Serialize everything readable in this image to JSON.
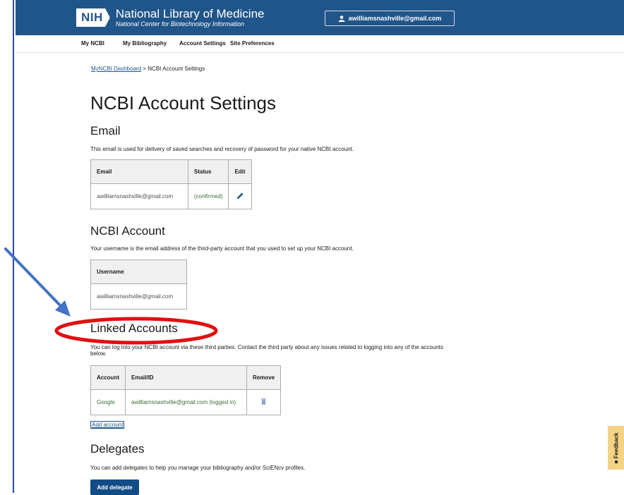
{
  "header": {
    "logo_badge": "NIH",
    "title": "National Library of Medicine",
    "subtitle": "National Center for Biotechnology Information",
    "account_email": "awilliamsnashville@gmail.com"
  },
  "nav": {
    "items": [
      "My NCBI",
      "My Bibliography",
      "Account Settings",
      "Site Preferences"
    ]
  },
  "breadcrumb": {
    "link": "MyNCBI Dashboard",
    "separator": " > ",
    "current": "NCBI Account Settings"
  },
  "page_title": "NCBI Account Settings",
  "email_section": {
    "heading": "Email",
    "description": "This email is used for delivery of saved searches and recovery of password for your native NCBI account.",
    "headers": [
      "Email",
      "Status",
      "Edit"
    ],
    "row": {
      "email": "awilliamsnashville@gmail.com",
      "status": "(confirmed)"
    }
  },
  "account_section": {
    "heading": "NCBI Account",
    "description": "Your username is the email address of the third-party account that you used to set up your NCBI account.",
    "header": "Username",
    "value": "awilliamsnashville@gmail.com"
  },
  "linked_section": {
    "heading": "Linked Accounts",
    "description": "You can log into your NCBI account via these third parties. Contact the third party about any issues related to logging into any of the accounts below.",
    "headers": [
      "Account",
      "Email/ID",
      "Remove"
    ],
    "row": {
      "account": "Google",
      "email": "awilliamsnashville@gmail.com (logged in)"
    },
    "add_link": "Add account"
  },
  "delegates_section": {
    "heading": "Delegates",
    "description": "You can add delegates to help you manage your bibliography and/or SciENcv profiles.",
    "button": "Add delegate"
  },
  "feedback": "Feedback",
  "colors": {
    "header": "#20558a",
    "annotation_red": "#e01010",
    "arrow": "#4472c4"
  }
}
